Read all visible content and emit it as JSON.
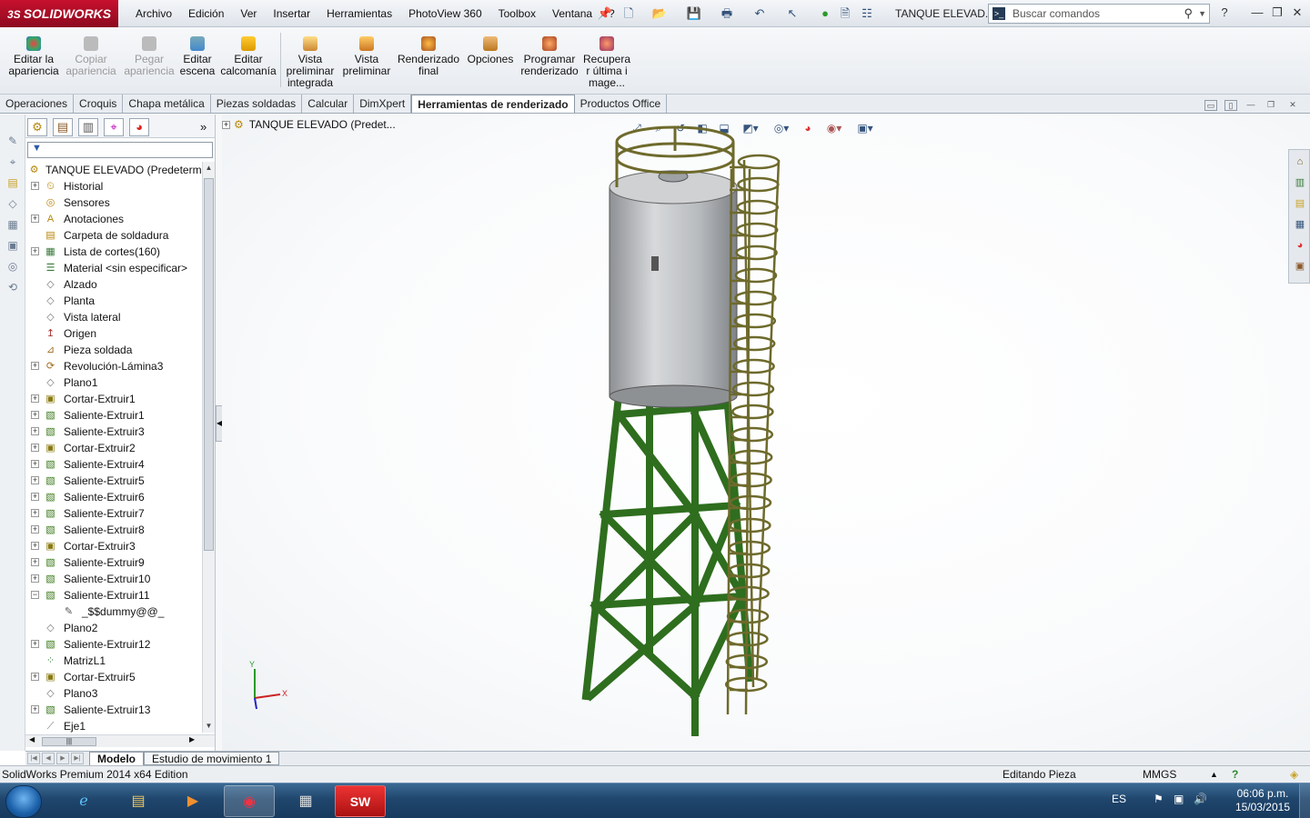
{
  "app": {
    "brand": "SOLIDWORKS",
    "menu": [
      "Archivo",
      "Edición",
      "Ver",
      "Insertar",
      "Herramientas",
      "PhotoView 360",
      "Toolbox",
      "Ventana",
      "?"
    ],
    "doc_title": "TANQUE ELEVAD...",
    "search_placeholder": "Buscar comandos"
  },
  "ribbon": {
    "buttons": [
      {
        "label": "Editar la apariencia",
        "enabled": true,
        "color": "#d23a3a"
      },
      {
        "label": "Copiar apariencia",
        "enabled": false,
        "color": "#b0b0b0"
      },
      {
        "label": "Pegar apariencia",
        "enabled": false,
        "color": "#b0b0b0"
      },
      {
        "label": "Editar escena",
        "enabled": true,
        "color": "#3a7bd5"
      },
      {
        "label": "Editar calcomanía",
        "enabled": true,
        "color": "#e0a020"
      },
      {
        "label": "Vista preliminar integrada",
        "enabled": true,
        "color": "#c98a2a"
      },
      {
        "label": "Vista preliminar",
        "enabled": true,
        "color": "#d0802a"
      },
      {
        "label": "Renderizado final",
        "enabled": true,
        "color": "#c0602a"
      },
      {
        "label": "Opciones",
        "enabled": true,
        "color": "#c98a2a"
      },
      {
        "label": "Programar renderizado",
        "enabled": true,
        "color": "#c0602a"
      },
      {
        "label": "Recuperar última image...",
        "enabled": true,
        "color": "#b05a2a"
      }
    ]
  },
  "tabs": [
    "Operaciones",
    "Croquis",
    "Chapa metálica",
    "Piezas soldadas",
    "Calcular",
    "DimXpert",
    "Herramientas de renderizado",
    "Productos Office"
  ],
  "active_tab": "Herramientas de renderizado",
  "feature_tree": {
    "root": "TANQUE ELEVADO  (Predetermi",
    "items": [
      {
        "label": "Historial",
        "icon": "history-icon",
        "expand": "+"
      },
      {
        "label": "Sensores",
        "icon": "sensor-icon",
        "expand": ""
      },
      {
        "label": "Anotaciones",
        "icon": "annotation-icon",
        "expand": "+"
      },
      {
        "label": "Carpeta de soldadura",
        "icon": "weld-folder-icon",
        "expand": ""
      },
      {
        "label": "Lista de cortes(160)",
        "icon": "cut-list-icon",
        "expand": "+"
      },
      {
        "label": "Material <sin especificar>",
        "icon": "material-icon",
        "expand": ""
      },
      {
        "label": "Alzado",
        "icon": "plane-icon",
        "expand": ""
      },
      {
        "label": "Planta",
        "icon": "plane-icon",
        "expand": ""
      },
      {
        "label": "Vista lateral",
        "icon": "plane-icon",
        "expand": ""
      },
      {
        "label": "Origen",
        "icon": "origin-icon",
        "expand": ""
      },
      {
        "label": "Pieza soldada",
        "icon": "weldment-icon",
        "expand": ""
      },
      {
        "label": "Revolución-Lámina3",
        "icon": "revolve-icon",
        "expand": "+"
      },
      {
        "label": "Plano1",
        "icon": "plane-icon",
        "expand": ""
      },
      {
        "label": "Cortar-Extruir1",
        "icon": "cut-extrude-icon",
        "expand": "+"
      },
      {
        "label": "Saliente-Extruir1",
        "icon": "boss-extrude-icon",
        "expand": "+"
      },
      {
        "label": "Saliente-Extruir3",
        "icon": "boss-extrude-icon",
        "expand": "+"
      },
      {
        "label": "Cortar-Extruir2",
        "icon": "cut-extrude-icon",
        "expand": "+"
      },
      {
        "label": "Saliente-Extruir4",
        "icon": "boss-extrude-icon",
        "expand": "+"
      },
      {
        "label": "Saliente-Extruir5",
        "icon": "boss-extrude-icon",
        "expand": "+"
      },
      {
        "label": "Saliente-Extruir6",
        "icon": "boss-extrude-icon",
        "expand": "+"
      },
      {
        "label": "Saliente-Extruir7",
        "icon": "boss-extrude-icon",
        "expand": "+"
      },
      {
        "label": "Saliente-Extruir8",
        "icon": "boss-extrude-icon",
        "expand": "+"
      },
      {
        "label": "Cortar-Extruir3",
        "icon": "cut-extrude-icon",
        "expand": "+"
      },
      {
        "label": "Saliente-Extruir9",
        "icon": "boss-extrude-icon",
        "expand": "+"
      },
      {
        "label": "Saliente-Extruir10",
        "icon": "boss-extrude-icon",
        "expand": "+"
      },
      {
        "label": "Saliente-Extruir11",
        "icon": "boss-extrude-icon",
        "expand": "−"
      },
      {
        "label": "_$$dummy@@_",
        "icon": "sketch-icon",
        "expand": "",
        "child": true
      },
      {
        "label": "Plano2",
        "icon": "plane-icon",
        "expand": ""
      },
      {
        "label": "Saliente-Extruir12",
        "icon": "boss-extrude-icon",
        "expand": "+"
      },
      {
        "label": "MatrizL1",
        "icon": "pattern-icon",
        "expand": ""
      },
      {
        "label": "Cortar-Extruir5",
        "icon": "cut-extrude-icon",
        "expand": "+"
      },
      {
        "label": "Plano3",
        "icon": "plane-icon",
        "expand": ""
      },
      {
        "label": "Saliente-Extruir13",
        "icon": "boss-extrude-icon",
        "expand": "+"
      },
      {
        "label": "Eje1",
        "icon": "axis-icon",
        "expand": ""
      }
    ]
  },
  "viewport": {
    "tree_label": "TANQUE ELEVADO  (Predet...",
    "triad_x": "X",
    "triad_y": "Y",
    "colors": {
      "tank": "#c4c6c8",
      "structure": "#2e6e1e",
      "ladder": "#6e6a2c"
    }
  },
  "bottom_tabs": [
    "Modelo",
    "Estudio de movimiento 1"
  ],
  "status": {
    "product": "SolidWorks Premium 2014 x64 Edition",
    "mode": "Editando Pieza",
    "units": "MMGS"
  },
  "taskbar": {
    "lang": "ES",
    "time": "06:06 p.m.",
    "date": "15/03/2015"
  }
}
